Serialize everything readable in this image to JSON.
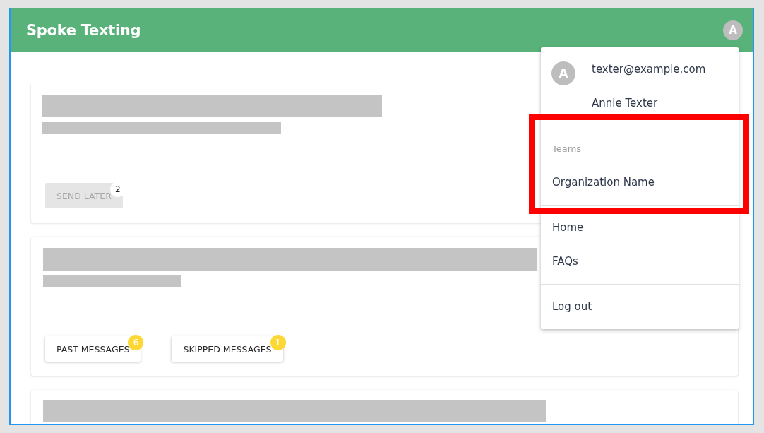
{
  "header": {
    "title": "Spoke Texting",
    "avatar": "A"
  },
  "cards": [
    {
      "kind": "with-actions",
      "actions": [
        {
          "label": "SEND LATER",
          "disabled": true,
          "badge": {
            "text": "2",
            "color": "#ffffff"
          }
        }
      ]
    },
    {
      "kind": "with-actions",
      "actions": [
        {
          "label": "PAST MESSAGES",
          "disabled": false,
          "badge": {
            "text": "6",
            "color": "#fdd835"
          }
        },
        {
          "label": "SKIPPED MESSAGES",
          "disabled": false,
          "badge": {
            "text": "1",
            "color": "#fdd835"
          }
        }
      ]
    },
    {
      "kind": "header-only"
    }
  ],
  "menu": {
    "user": {
      "avatar": "A",
      "email": "texter@example.com",
      "name": "Annie Texter"
    },
    "sections": [
      {
        "subheader": "Teams",
        "highlighted": true,
        "items": [
          "Organization Name"
        ]
      },
      {
        "highlighted": false,
        "items": [
          "Home",
          "FAQs"
        ]
      },
      {
        "highlighted": false,
        "items": [
          "Log out"
        ]
      }
    ]
  }
}
